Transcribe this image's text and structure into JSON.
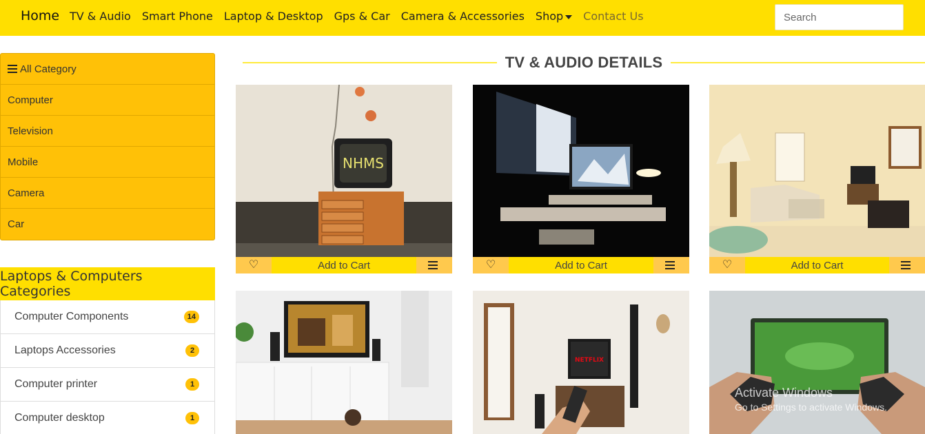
{
  "navbar": {
    "brand": "Home",
    "items": [
      "TV & Audio",
      "Smart Phone",
      "Laptop & Desktop",
      "Gps & Car",
      "Camera & Accessories",
      "Shop"
    ],
    "contact": "Contact Us",
    "search_placeholder": "Search"
  },
  "sidebar": {
    "title": "All Category",
    "items": [
      "Computer",
      "Television",
      "Mobile",
      "Camera",
      "Car"
    ]
  },
  "laptops": {
    "title": "Laptops & Computers Categories",
    "items": [
      {
        "label": "Computer Components",
        "count": "14"
      },
      {
        "label": "Laptops Accessories",
        "count": "2"
      },
      {
        "label": "Computer printer",
        "count": "1"
      },
      {
        "label": "Computer desktop",
        "count": "1"
      }
    ]
  },
  "section": {
    "title": "TV & AUDIO DETAILS"
  },
  "products": [
    {
      "cart_label": "Add to Cart",
      "image": "old-tv-on-wooden-cabinet",
      "graffiti": "NHMS"
    },
    {
      "cart_label": "Add to Cart",
      "image": "desk-with-monitors-at-night"
    },
    {
      "cart_label": "Add to Cart",
      "image": "living-room-with-tv"
    },
    {
      "image": "tv-on-white-console"
    },
    {
      "image": "hand-with-remote-and-tv",
      "screen_text": "NETFLIX"
    },
    {
      "image": "gaming-controllers-and-tv"
    }
  ],
  "watermark": {
    "line1": "Activate Windows",
    "line2": "Go to Settings to activate Windows."
  },
  "colors": {
    "navbar": "#ffdf00",
    "category": "#ffc107",
    "accent_line": "#ffeb3b"
  }
}
